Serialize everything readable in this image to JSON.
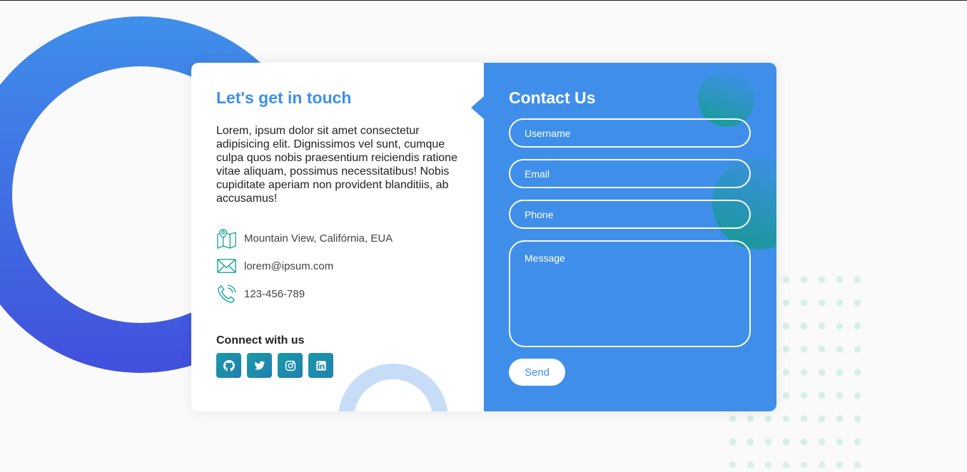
{
  "info": {
    "title": "Let's get in touch",
    "text": "Lorem, ipsum dolor sit amet consectetur adipisicing elit. Dignissimos vel sunt, cumque culpa quos nobis praesentium reiciendis ratione vitae aliquam, possimus necessitatibus! Nobis cupiditate aperiam non provident blanditiis, ab accusamus!",
    "address": "Mountain View, Califórnia, EUA",
    "email": "lorem@ipsum.com",
    "phone": "123-456-789",
    "connect_title": "Connect with us",
    "socials": [
      "github-icon",
      "twitter-icon",
      "instagram-icon",
      "linkedin-icon"
    ]
  },
  "form": {
    "title": "Contact Us",
    "username_placeholder": "Username",
    "email_placeholder": "Email",
    "phone_placeholder": "Phone",
    "message_placeholder": "Message",
    "send_label": "Send"
  },
  "colors": {
    "accent": "#3f8fea",
    "teal": "#1b9aa8",
    "ring_start": "#3f8fea",
    "ring_end": "#4150dd"
  }
}
